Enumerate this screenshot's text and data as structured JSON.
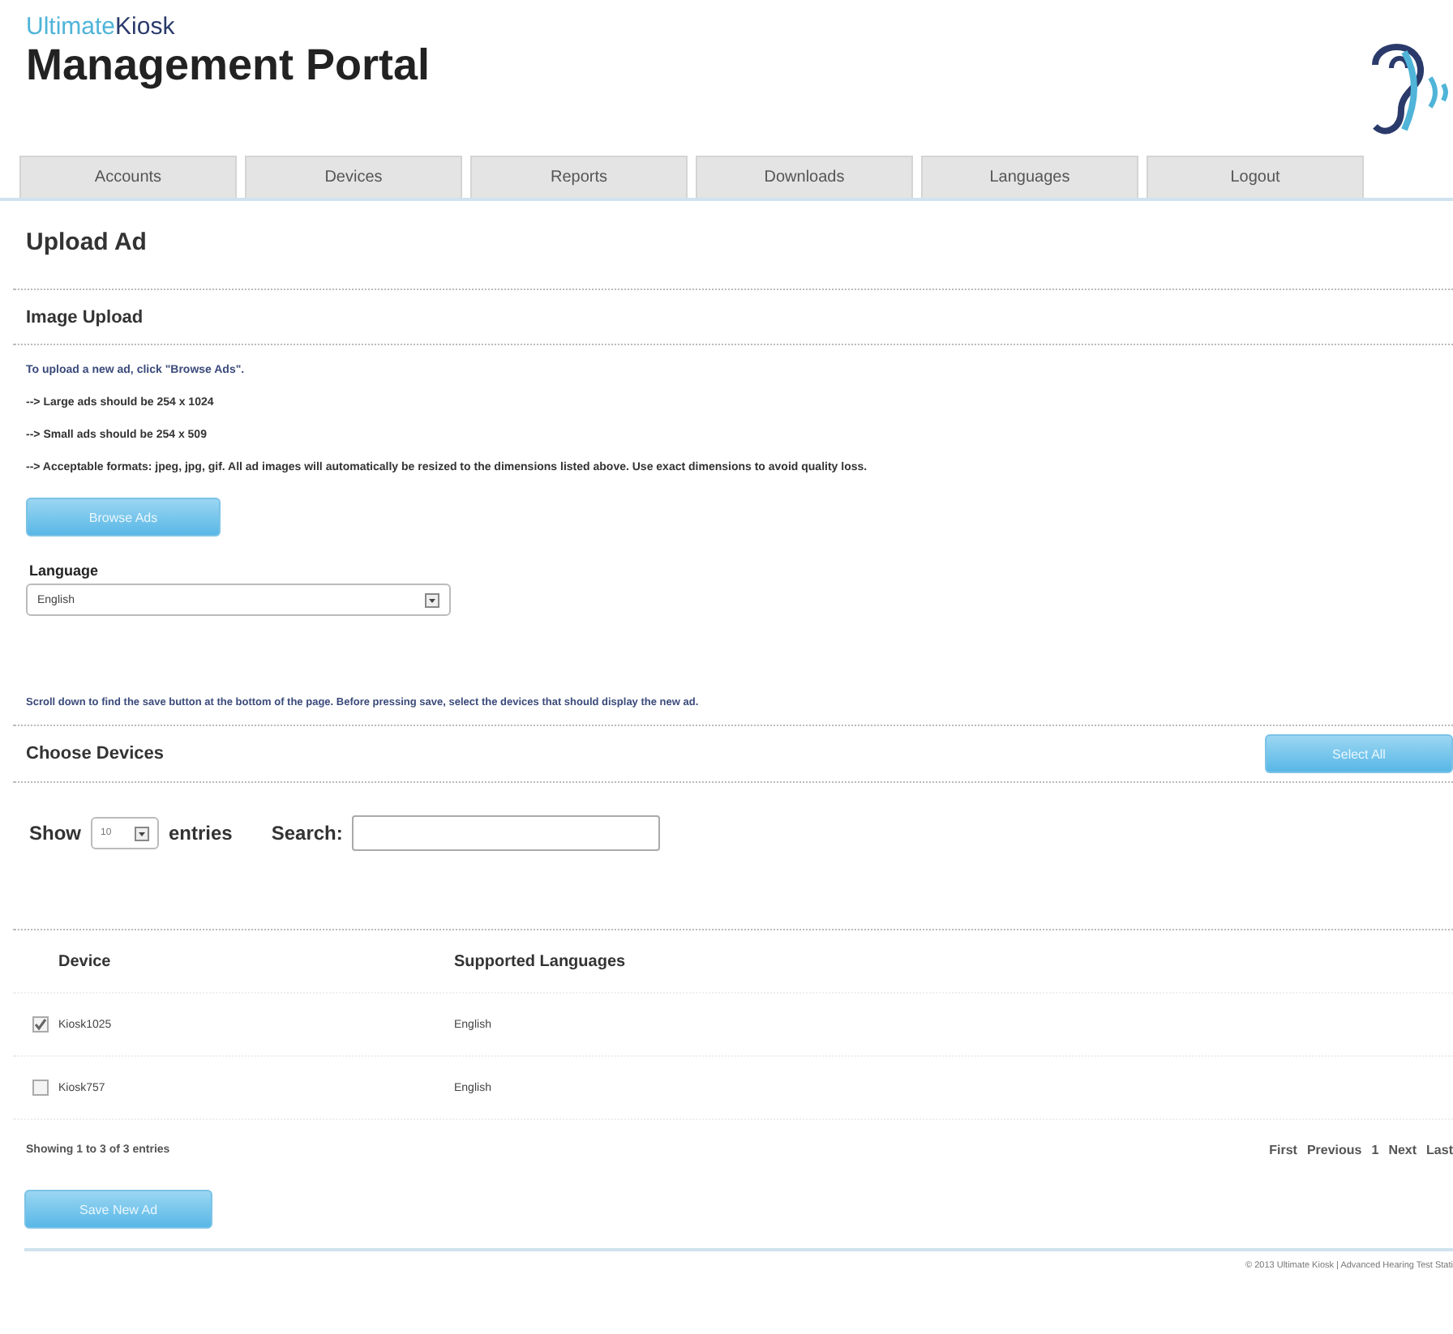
{
  "header": {
    "brand_light": "Ultimate",
    "brand_dark": "Kiosk",
    "title": "Management Portal"
  },
  "tabs": [
    {
      "label": "Accounts",
      "selected": false
    },
    {
      "label": "Devices",
      "selected": false
    },
    {
      "label": "Reports",
      "selected": false
    },
    {
      "label": "Downloads",
      "selected": false
    },
    {
      "label": "Languages",
      "selected": false
    },
    {
      "label": "Logout",
      "selected": false
    }
  ],
  "page_title": "Upload Ad",
  "image_upload": {
    "heading": "Image Upload",
    "intro": "To upload a new ad, click \"Browse Ads\".",
    "notes": [
      "--> Large ads should be 254 x 1024",
      "--> Small ads should be 254 x 509",
      "--> Acceptable formats: jpeg, jpg, gif. All ad images will automatically be resized to the dimensions listed above. Use exact dimensions to avoid quality loss."
    ],
    "browse_button": "Browse Ads",
    "language_label": "Language",
    "language_value": "English"
  },
  "instructions": "Scroll down to find the save button at the bottom of the page. Before pressing save, select the devices that should display the new ad.",
  "choose_devices": {
    "heading": "Choose Devices",
    "select_all_button": "Select All",
    "show_label": "Show",
    "page_size": "10",
    "entries_label": "entries",
    "search_label": "Search:",
    "columns": [
      "Device",
      "Supported Languages"
    ],
    "rows": [
      {
        "device": "Kiosk1025",
        "languages": "English",
        "checked": true
      },
      {
        "device": "Kiosk757",
        "languages": "English",
        "checked": false
      }
    ],
    "info": "Showing 1 to 3 of 3 entries",
    "pagination": [
      "First",
      "Previous",
      "1",
      "Next",
      "Last"
    ]
  },
  "save_button": "Save New Ad",
  "footer": "© 2013 Ultimate Kiosk | Advanced Hearing Test Stati"
}
